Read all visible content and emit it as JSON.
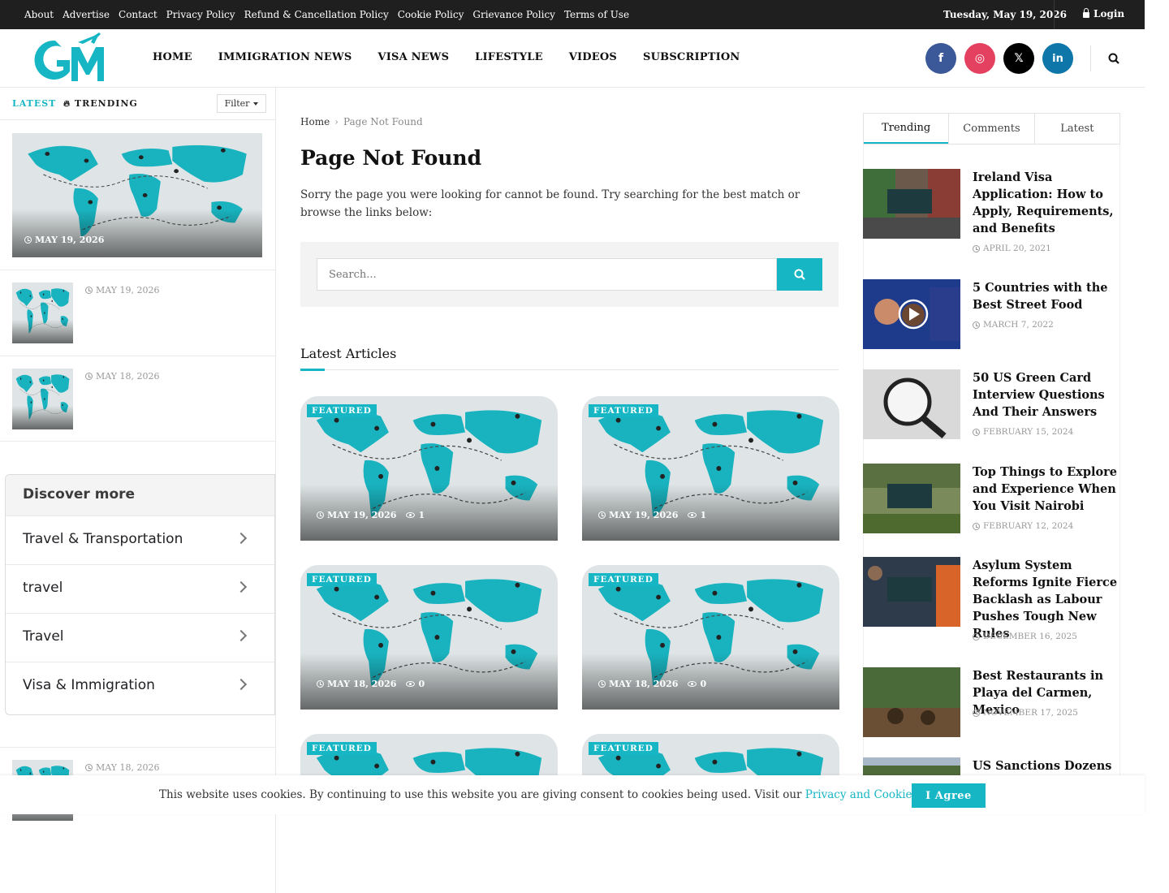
{
  "topbar": {
    "links": [
      "About",
      "Advertise",
      "Contact",
      "Privacy Policy",
      "Refund & Cancellation Policy",
      "Cookie Policy",
      "Grievance Policy",
      "Terms of Use"
    ],
    "date": "Tuesday, May 19, 2026",
    "login": "Login"
  },
  "nav": [
    "HOME",
    "IMMIGRATION NEWS",
    "VISA NEWS",
    "LIFESTYLE",
    "VIDEOS",
    "SUBSCRIPTION"
  ],
  "social": [
    {
      "icon": "facebook-icon",
      "glyph": "f",
      "color": "#3b5998"
    },
    {
      "icon": "instagram-icon",
      "glyph": "◎",
      "color": "#e4405f"
    },
    {
      "icon": "x-icon",
      "glyph": "𝕏",
      "color": "#000000"
    },
    {
      "icon": "linkedin-icon",
      "glyph": "in",
      "color": "#0e76a8"
    }
  ],
  "left": {
    "tab_latest": "LATEST",
    "tab_trending": "TRENDING",
    "filter": "Filter",
    "lead_date": "MAY 19, 2026",
    "items": [
      {
        "date": "MAY 19, 2026"
      },
      {
        "date": "MAY 18, 2026"
      },
      {
        "date": "MAY 18, 2026"
      }
    ],
    "discover_title": "Discover more",
    "discover": [
      "Travel & Transportation",
      "travel",
      "Travel",
      "Visa & Immigration"
    ]
  },
  "breadcrumb": {
    "home": "Home",
    "current": "Page Not Found"
  },
  "page_title": "Page Not Found",
  "page_message": "Sorry the page you were looking for cannot be found. Try searching for the best match or browse the links below:",
  "search": {
    "placeholder": "Search..."
  },
  "latest_heading": "Latest Articles",
  "cards": [
    {
      "badge": "FEATURED",
      "date": "MAY 19, 2026",
      "views": "1"
    },
    {
      "badge": "FEATURED",
      "date": "MAY 19, 2026",
      "views": "1"
    },
    {
      "badge": "FEATURED",
      "date": "MAY 18, 2026",
      "views": "0"
    },
    {
      "badge": "FEATURED",
      "date": "MAY 18, 2026",
      "views": "0"
    },
    {
      "badge": "FEATURED",
      "date": "",
      "views": ""
    },
    {
      "badge": "FEATURED",
      "date": "",
      "views": ""
    }
  ],
  "right": {
    "tabs": [
      "Trending",
      "Comments",
      "Latest"
    ],
    "items": [
      {
        "title": "Ireland Visa Application: How to Apply, Requirements, and Benefits",
        "date": "APRIL 20, 2021"
      },
      {
        "title": "5 Countries with the Best Street Food",
        "date": "MARCH 7, 2022"
      },
      {
        "title": "50 US Green Card Interview Questions And Their Answers",
        "date": "FEBRUARY 15, 2024"
      },
      {
        "title": "Top Things to Explore and Experience When You Visit Nairobi",
        "date": "FEBRUARY 12, 2024"
      },
      {
        "title": "Asylum System Reforms Ignite Fierce Backlash as Labour Pushes Tough New Rules",
        "date": "DECEMBER 16, 2025"
      },
      {
        "title": "Best Restaurants in Playa del Carmen, Mexico",
        "date": "NOVEMBER 17, 2025"
      },
      {
        "title": "US Sanctions Dozens of",
        "date": ""
      }
    ]
  },
  "cookie": {
    "text": "This website uses cookies. By continuing to use this website you are giving consent to cookies being used. Visit our ",
    "link": "Privacy and Cookie Policy",
    "after": ".",
    "button": "I Agree"
  },
  "colors": {
    "accent": "#16b6c4",
    "topbar": "#1f1f1f"
  }
}
